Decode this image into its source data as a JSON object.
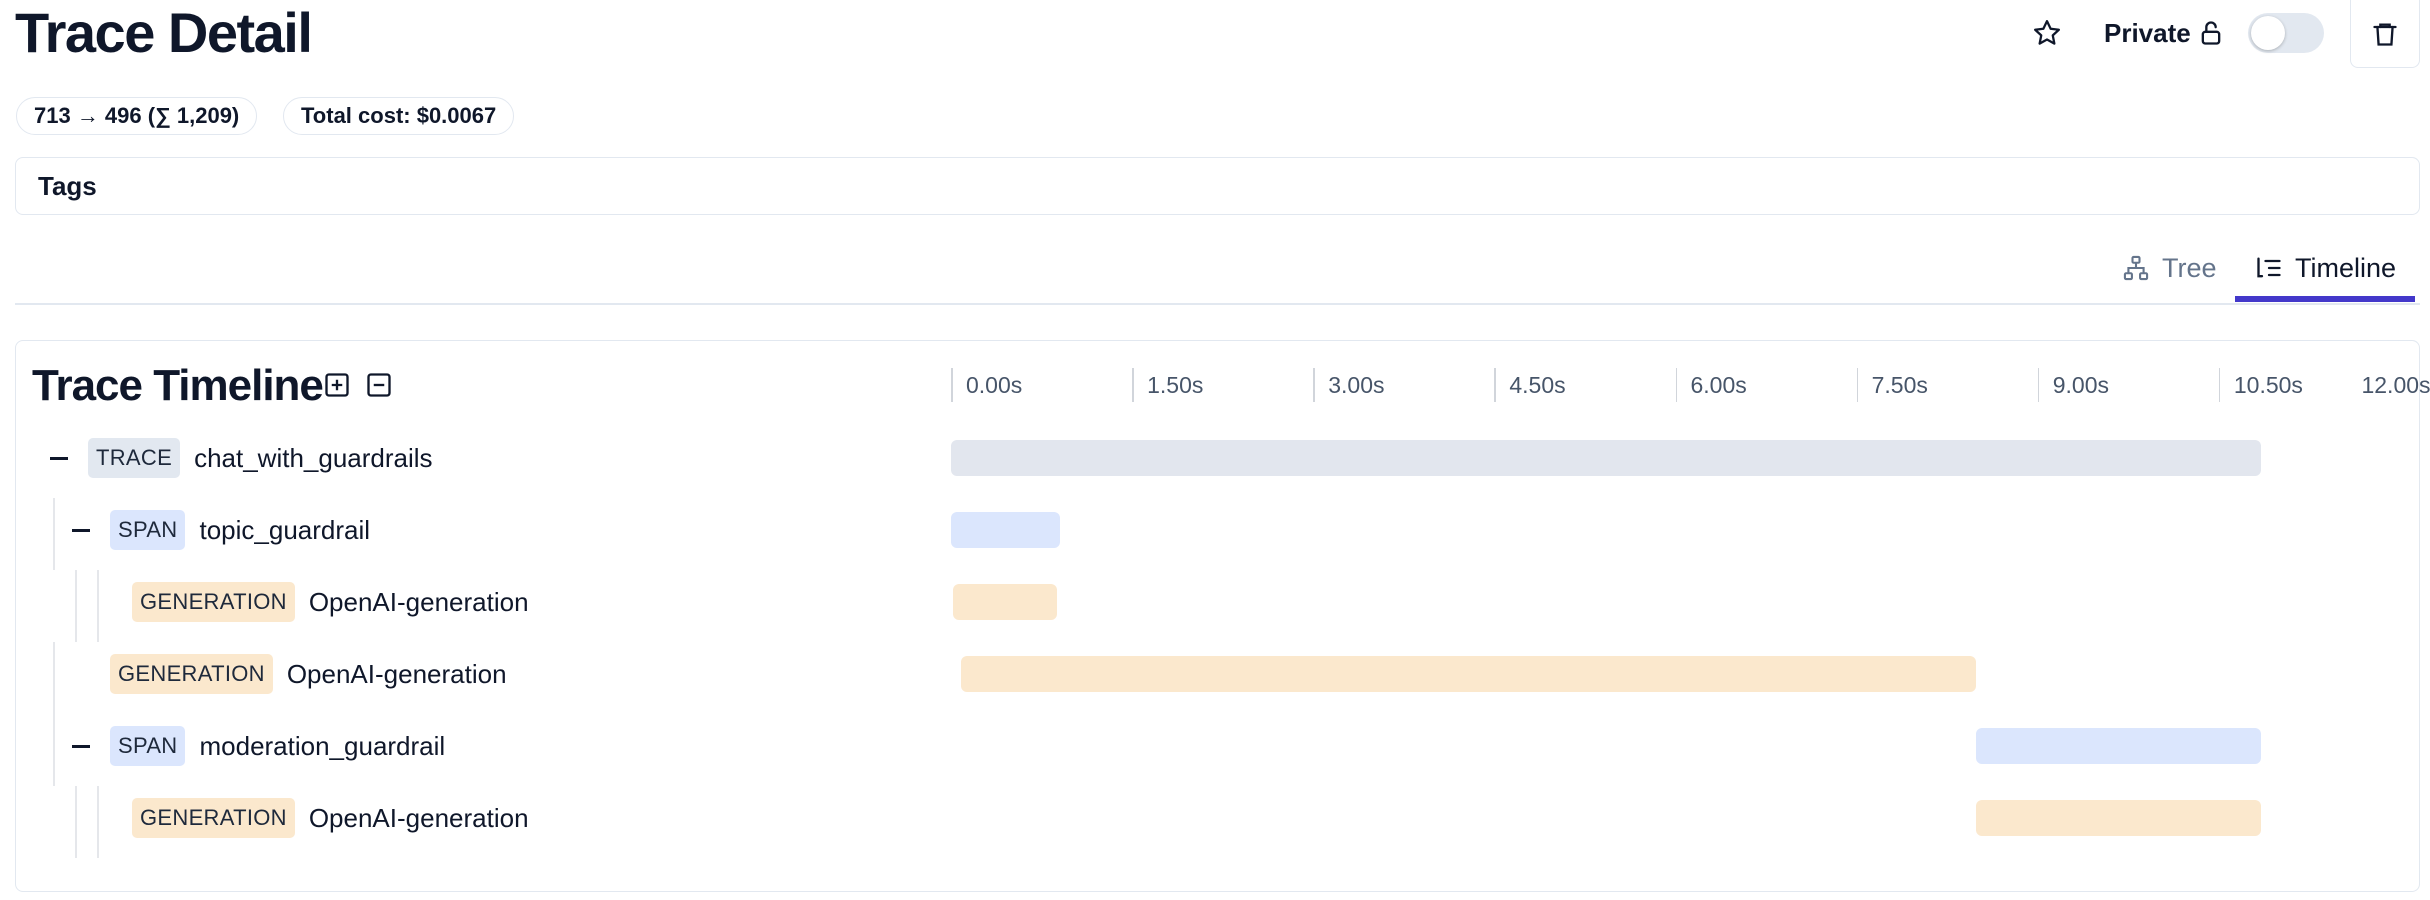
{
  "header": {
    "title": "Trace Detail",
    "private_label": "Private",
    "private_toggle_on": false
  },
  "stats": {
    "tokens": "713 → 496 (∑ 1,209)",
    "cost": "Total cost: $0.0067"
  },
  "tags": {
    "label": "Tags"
  },
  "tabs": [
    {
      "label": "Tree",
      "active": false,
      "icon": "tree-icon"
    },
    {
      "label": "Timeline",
      "active": true,
      "icon": "timeline-icon"
    }
  ],
  "timeline": {
    "title": "Trace Timeline",
    "axis": {
      "unit": "s",
      "min": 0,
      "max": 12,
      "ticks": [
        "0.00s",
        "1.50s",
        "3.00s",
        "4.50s",
        "6.00s",
        "7.50s",
        "9.00s",
        "10.50s",
        "12.00s"
      ]
    },
    "rows": [
      {
        "type": "TRACE",
        "name": "chat_with_guardrails",
        "depth": 0,
        "collapsible": true,
        "start": 0.0,
        "end": 10.85
      },
      {
        "type": "SPAN",
        "name": "topic_guardrail",
        "depth": 1,
        "collapsible": true,
        "start": 0.0,
        "end": 0.9
      },
      {
        "type": "GENERATION",
        "name": "OpenAI-generation",
        "depth": 2,
        "collapsible": false,
        "start": 0.02,
        "end": 0.88
      },
      {
        "type": "GENERATION",
        "name": "OpenAI-generation",
        "depth": 1,
        "collapsible": false,
        "start": 0.08,
        "end": 8.49
      },
      {
        "type": "SPAN",
        "name": "moderation_guardrail",
        "depth": 1,
        "collapsible": true,
        "start": 8.49,
        "end": 10.85
      },
      {
        "type": "GENERATION",
        "name": "OpenAI-generation",
        "depth": 2,
        "collapsible": false,
        "start": 8.49,
        "end": 10.85
      }
    ]
  },
  "colors": {
    "accent": "#4338ca",
    "trace": "#e2e6ee",
    "span": "#dbe6fd",
    "generation": "#fbe8cd"
  }
}
